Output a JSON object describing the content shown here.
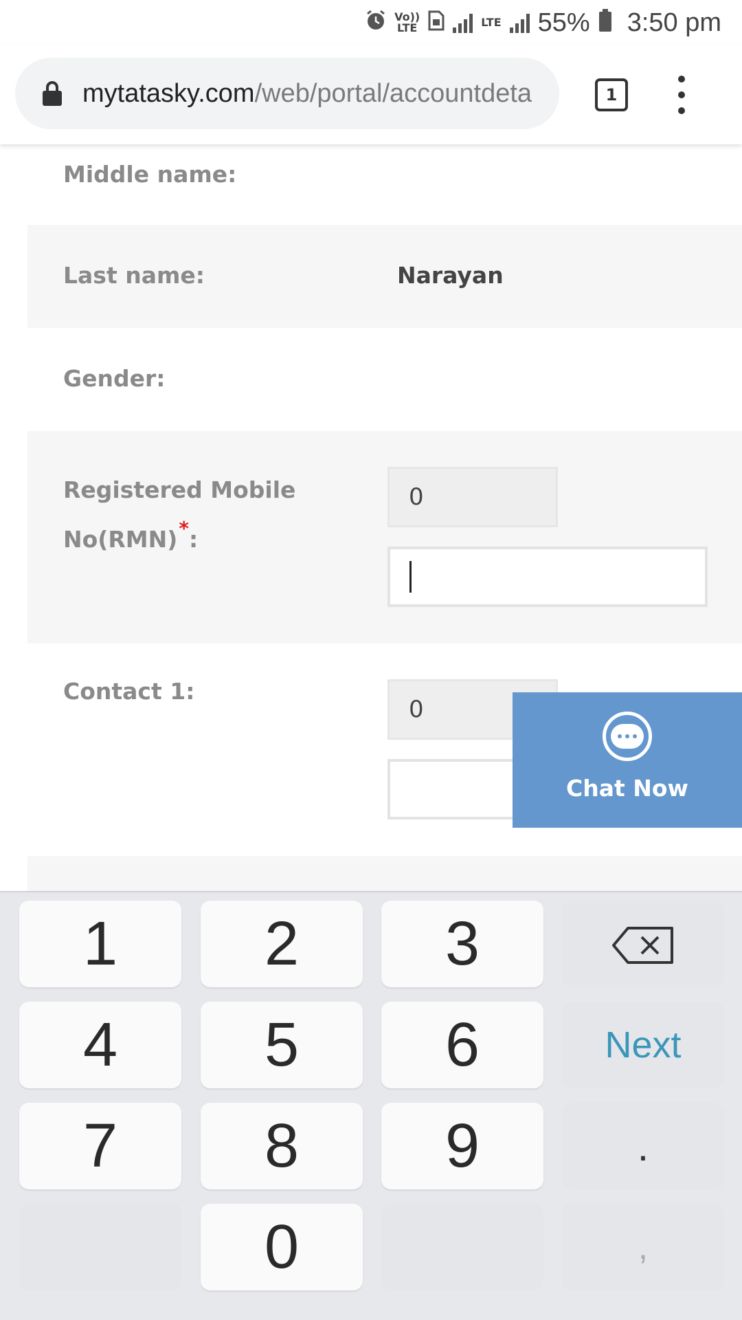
{
  "status_bar": {
    "volte_label": "Vo))",
    "volte_sub": "LTE",
    "lte_label": "LTE",
    "battery": "55%",
    "time": "3:50 pm"
  },
  "browser": {
    "url_domain": "mytatasky.com",
    "url_path": "/web/portal/accountdeta",
    "tab_count": "1"
  },
  "form": {
    "middle_name_label": "Middle name:",
    "last_name_label": "Last name:",
    "last_name_value": "Narayan",
    "gender_label": "Gender:",
    "rmn_label_line1": "Registered Mobile",
    "rmn_label_line2": "No(RMN)",
    "rmn_required": "*",
    "rmn_colon": ":",
    "rmn_code": "0",
    "rmn_number": "",
    "contact1_label": "Contact 1:",
    "contact1_code": "0",
    "contact1_number": ""
  },
  "chat": {
    "label": "Chat Now"
  },
  "keyboard": {
    "keys": [
      "1",
      "2",
      "3",
      "4",
      "5",
      "6",
      "7",
      "8",
      "9",
      "0"
    ],
    "next_label": "Next",
    "dot": ".",
    "comma": ","
  },
  "colors": {
    "chat_bg": "#6397ce",
    "next_key": "#3b96ba",
    "required": "#e02020",
    "row_shade": "#f6f6f6"
  }
}
